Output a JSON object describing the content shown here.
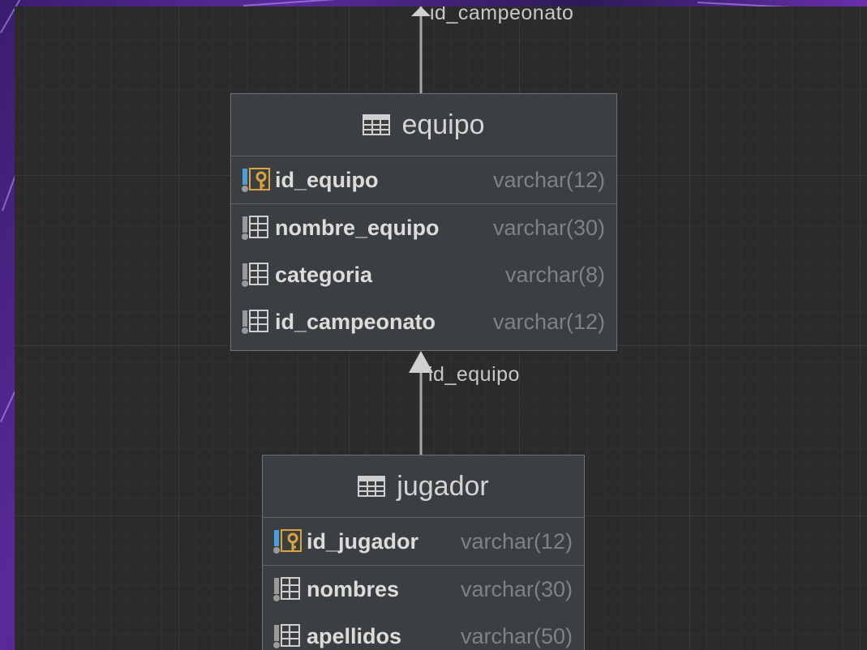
{
  "relations": [
    {
      "label": "id_campeonato"
    },
    {
      "label": "id_equipo"
    }
  ],
  "entities": [
    {
      "name": "equipo",
      "fields": [
        {
          "name": "id_equipo",
          "type": "varchar(12)",
          "key": "primary"
        },
        {
          "name": "nombre_equipo",
          "type": "varchar(30)",
          "key": "none"
        },
        {
          "name": "categoria",
          "type": "varchar(8)",
          "key": "none"
        },
        {
          "name": "id_campeonato",
          "type": "varchar(12)",
          "key": "none"
        }
      ]
    },
    {
      "name": "jugador",
      "fields": [
        {
          "name": "id_jugador",
          "type": "varchar(12)",
          "key": "primary"
        },
        {
          "name": "nombres",
          "type": "varchar(30)",
          "key": "none"
        },
        {
          "name": "apellidos",
          "type": "varchar(50)",
          "key": "none"
        }
      ]
    }
  ],
  "colors": {
    "canvas": "#2b2b2b",
    "entity_fill": "#3c3f41",
    "key_icon": "#d9a441",
    "column_icon_accent": "#4a9fd8"
  }
}
